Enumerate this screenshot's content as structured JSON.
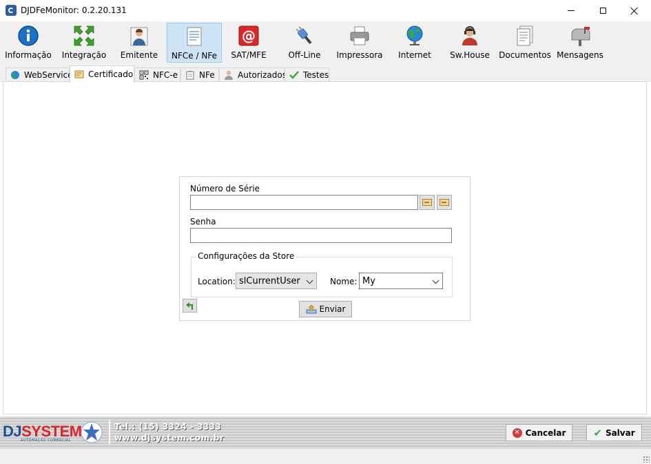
{
  "window": {
    "title": "DJDFeMonitor: 0.2.20.131"
  },
  "toolbar": {
    "items": [
      {
        "label": "Informação",
        "icon": "info-icon"
      },
      {
        "label": "Integração",
        "icon": "integration-arrows-icon"
      },
      {
        "label": "Emitente",
        "icon": "person-icon"
      },
      {
        "label": "NFCe / NFe",
        "icon": "document-icon",
        "active": true
      },
      {
        "label": "SAT/MFE",
        "icon": "at-sign-icon"
      },
      {
        "label": "Off-Line",
        "icon": "plug-icon"
      },
      {
        "label": "Impressora",
        "icon": "printer-icon"
      },
      {
        "label": "Internet",
        "icon": "globe-icon"
      },
      {
        "label": "Sw.House",
        "icon": "headset-user-icon"
      },
      {
        "label": "Documentos",
        "icon": "documents-icon"
      },
      {
        "label": "Mensagens",
        "icon": "mailbox-icon"
      }
    ]
  },
  "tabs": [
    {
      "label": "WebService",
      "icon": "globe-icon"
    },
    {
      "label": "Certificado",
      "icon": "certificate-icon",
      "active": true
    },
    {
      "label": "NFC-e",
      "icon": "qrcode-icon"
    },
    {
      "label": "NFe",
      "icon": "clipboard-icon"
    },
    {
      "label": "Autorizados",
      "icon": "users-icon"
    },
    {
      "label": "Testes",
      "icon": "check-icon"
    }
  ],
  "certificate": {
    "serial_label": "Número de Série",
    "serial_value": "",
    "password_label": "Senha",
    "password_value": "",
    "store_group_title": "Configurações da Store",
    "location_label": "Location:",
    "location_value": "slCurrentUser",
    "name_label": "Nome:",
    "name_value": "My",
    "send_label": "Enviar"
  },
  "footer": {
    "logo_dj": "DJ",
    "logo_system": "SYSTEM",
    "logo_subtitle": "AUTOMAÇÃO COMERCIAL",
    "phone": "Tel.: (15) 3324 - 3333",
    "website": "www.djsystem.com.br",
    "cancel_label": "Cancelar",
    "save_label": "Salvar"
  },
  "colors": {
    "active_tool_bg": "#cde4f7",
    "brand_blue": "#1d4f94",
    "brand_red": "#d7262c"
  }
}
